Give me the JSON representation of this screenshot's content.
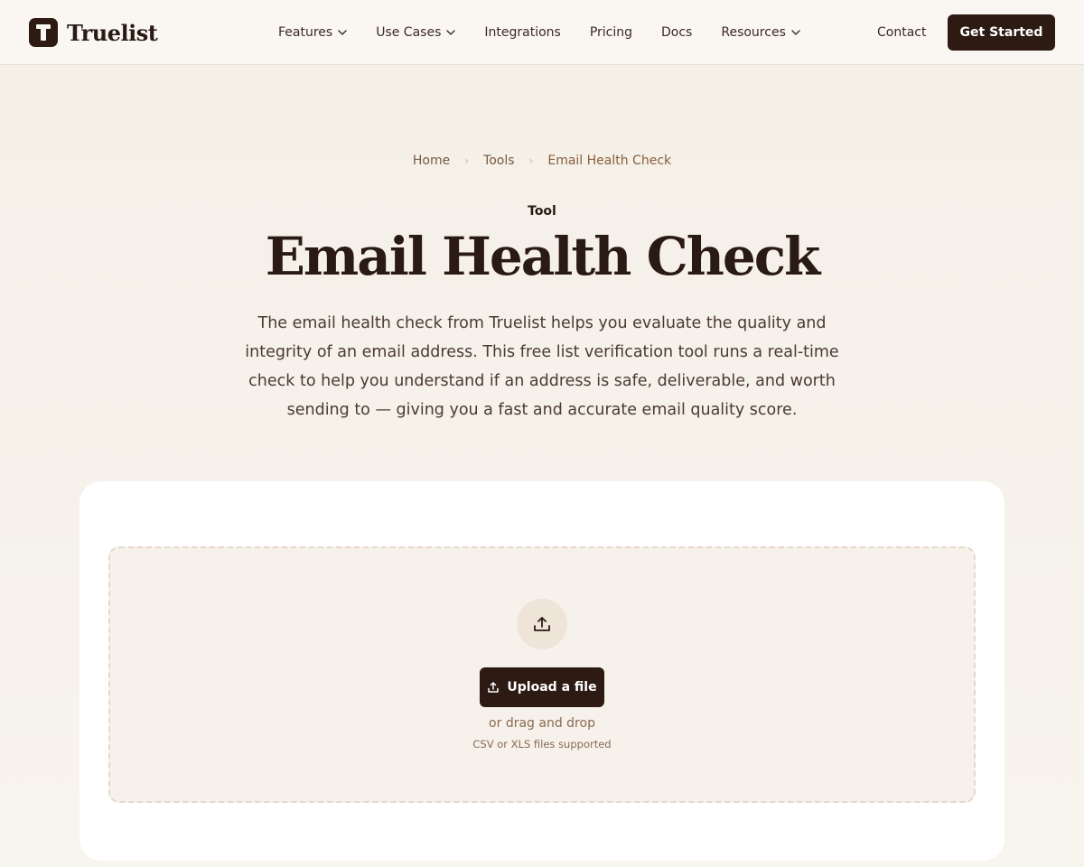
{
  "brand": {
    "name": "Truelist"
  },
  "nav": {
    "items": [
      {
        "label": "Features",
        "dropdown": true
      },
      {
        "label": "Use Cases",
        "dropdown": true
      },
      {
        "label": "Integrations",
        "dropdown": false
      },
      {
        "label": "Pricing",
        "dropdown": false
      },
      {
        "label": "Docs",
        "dropdown": false
      },
      {
        "label": "Resources",
        "dropdown": true
      }
    ],
    "contact_label": "Contact",
    "cta_label": "Get Started"
  },
  "breadcrumb": {
    "items": [
      "Home",
      "Tools",
      "Email Health Check"
    ]
  },
  "hero": {
    "eyebrow": "Tool",
    "title": "Email Health Check",
    "description": "The email health check from Truelist helps you evaluate the quality and integrity of an email address. This free list verification tool runs a real-time check to help you understand if an address is safe, deliverable, and worth sending to — giving you a fast and accurate email quality score."
  },
  "upload": {
    "button_label": "Upload a file",
    "drag_text": "or drag and drop",
    "supported_text": "CSV or XLS files supported",
    "icon": "upload-icon"
  },
  "colors": {
    "brand_dark": "#2c1a13",
    "background": "#f6f1ea",
    "card": "#ffffff",
    "accent_text": "#8a5e3c"
  }
}
